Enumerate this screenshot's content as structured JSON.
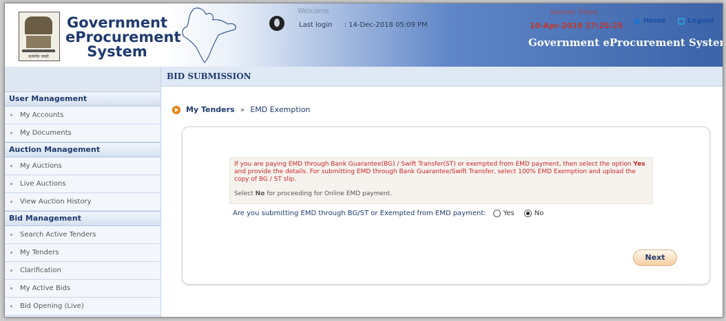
{
  "header": {
    "brand_line1": "Government",
    "brand_line2": "eProcurement",
    "brand_line3": "System",
    "emblem_motto": "सत्यमेव जयते",
    "welcome_label": "Welcome",
    "welcome_value": "",
    "last_login_label": "Last login",
    "last_login_value": ": 14-Dec-2018 05:09 PM",
    "server_time_label": "Server Time",
    "server_time": "10-Apr-2019 17:25:25",
    "home_label": "Home",
    "logout_label": "Logout",
    "system_title": "Government eProcurement System"
  },
  "sidebar": {
    "sections": [
      {
        "title": "User Management",
        "items": [
          "My Accounts",
          "My Documents"
        ]
      },
      {
        "title": "Auction Management",
        "items": [
          "My Auctions",
          "Live Auctions",
          "View Auction History"
        ]
      },
      {
        "title": "Bid Management",
        "items": [
          "Search Active Tenders",
          "My Tenders",
          "Clarification",
          "My Active Bids",
          "Bid Opening (Live)"
        ]
      }
    ]
  },
  "main": {
    "section_title": "BID SUBMISSION",
    "breadcrumb": {
      "link": "My Tenders",
      "separator": "»",
      "current": "EMD Exemption"
    },
    "info": {
      "line1_pre": "If you are paying EMD through Bank Guarantee(BG) / Swift Transfer(ST) or exempted from EMD payment, then select the option ",
      "line1_bold": "Yes",
      "line1_post": " and provide the details. For submitting EMD through Bank Guarantee/Swift Transfer, select 100% EMD Exemption and upload the copy of BG / ST slip.",
      "note_pre": "Select ",
      "note_bold": "No",
      "note_post": " for proceeding for Online EMD payment."
    },
    "question": "Are you submitting EMD through BG/ST or Exempted from EMD payment:",
    "option_yes": "Yes",
    "option_no": "No",
    "selected": "No",
    "next_label": "Next"
  },
  "colors": {
    "accent": "#1f3a6e",
    "alert": "#c62828",
    "header_blue": "#3b63a8"
  }
}
